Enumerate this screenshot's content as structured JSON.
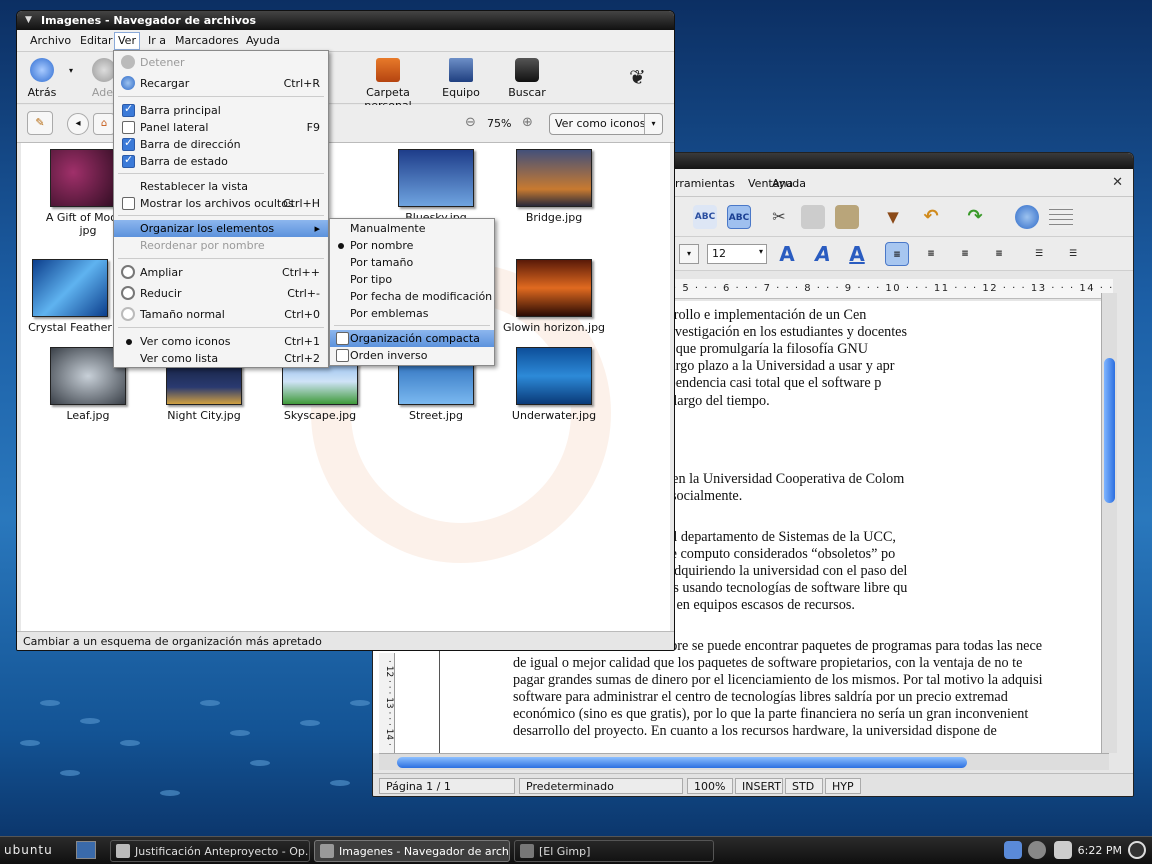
{
  "writer": {
    "menu": [
      "rramientas",
      "Ventana",
      "Ayuda"
    ],
    "fontsize": "12",
    "ruler": "· 5 · · · 6 · · · 7 · · · 8 · · · 9 · · · 10 · · · 11 · · · 12 · · · 13 · · · 14 · · · 15 ·",
    "vruler": "· 12 · · · 13 · · · 14 ·",
    "paragraphs": [
      "ventajas que tendría el desarrollo e implementación de un Cen",
      "UCC es que fomentaría la investigación en los estudiantes y docentes",
      "entas no privativas, a su vez que promulgaría la filosofía GNU",
      "o cual podría influenciar a largo plazo a la Universidad a usar y apr",
      "re libre rompiendo así la dependencia casi total que el software p",
      "e usuarios informáticos a lo largo del tiempo.",
      "centro de tecnologías libres en la Universidad Cooperativa de Colom",
      "ctible técnica, económica y socialmente.",
      "or medio de una entrevista al departamento de Sistemas de la UCC,",
      "rsidad dispone de equipos de computo considerados “obsoletos” po",
      "ologías de software que va adquiriendo la universidad con el paso del",
      "pos pueden ser aprovechados usando tecnologías de software libre qu",
      "para funcionar óptimamente en equipos escasos de recursos.",
      "En el mundo del software libre se puede encontrar paquetes de programas para todas las nece",
      "de igual o mejor calidad que los paquetes de software propietarios, con la ventaja de no te",
      "pagar grandes sumas de dinero por el licenciamiento de los mismos. Por tal motivo la adquisi",
      "software para administrar el centro de tecnologías libres saldría por un precio extremad",
      "económico (sino es que gratis), por lo que la parte financiera no sería un gran inconvenient",
      "desarrollo del proyecto. En cuanto a los recursos hardware, la universidad dispone de"
    ],
    "status": {
      "page": "Página  1 / 1",
      "style": "Predeterminado",
      "zoom": "100%",
      "insert": "INSERT",
      "std": "STD",
      "hyp": "HYP"
    }
  },
  "nautilus": {
    "title": "Imagenes - Navegador de archivos",
    "menu": [
      "Archivo",
      "Editar",
      "Ver",
      "Ir a",
      "Marcadores",
      "Ayuda"
    ],
    "toolbar": {
      "back": "Atrás",
      "forward": "Adel",
      "home": "Carpeta personal",
      "computer": "Equipo",
      "search": "Buscar"
    },
    "zoom": "75%",
    "view_mode": "Ver como iconos",
    "files": [
      {
        "name": "A Gift of Moonlight.jpg",
        "line1": "A Gift of Moonli",
        "line2": "jpg",
        "color": "#3a1030"
      },
      {
        "name": "Bluesky.jpg",
        "line1": "Bluesky.jpg",
        "line2": "",
        "color": "#3b6fbf"
      },
      {
        "name": "Bridge.jpg",
        "line1": "Bridge.jpg",
        "line2": "",
        "color": "#2c3650"
      },
      {
        "name": "Crystal Feather.jpg",
        "line1": "Crystal Feather",
        "line2": "",
        "color": "#1f6fb0"
      },
      {
        "name": "Glowin horizon.jpg",
        "line1": "Glowin horizon.jpg",
        "line2": "",
        "color": "#a8461c"
      },
      {
        "name": "Leaf.jpg",
        "line1": "Leaf.jpg",
        "line2": "",
        "color": "#5d6670"
      },
      {
        "name": "Night City.jpg",
        "line1": "Night City.jpg",
        "line2": "",
        "color": "#1a2540"
      },
      {
        "name": "Skyscape.jpg",
        "line1": "Skyscape.jpg",
        "line2": "",
        "color": "#3f9a3a"
      },
      {
        "name": "Street.jpg",
        "line1": "Street.jpg",
        "line2": "",
        "color": "#2876c0"
      },
      {
        "name": "Underwater.jpg",
        "line1": "Underwater.jpg",
        "line2": "",
        "color": "#1157a8"
      }
    ],
    "status": "Cambiar a un esquema de organización más apretado"
  },
  "ver_menu": {
    "detener": "Detener",
    "recargar": "Recargar",
    "recargar_acc": "Ctrl+R",
    "barra_principal": "Barra principal",
    "panel_lateral": "Panel lateral",
    "panel_lateral_acc": "F9",
    "barra_direccion": "Barra de dirección",
    "barra_estado": "Barra de estado",
    "restablecer": "Restablecer la vista",
    "ocultos": "Mostrar los archivos ocultos",
    "ocultos_acc": "Ctrl+H",
    "organizar": "Organizar los elementos",
    "reordenar": "Reordenar por nombre",
    "ampliar": "Ampliar",
    "ampliar_acc": "Ctrl++",
    "reducir": "Reducir",
    "reducir_acc": "Ctrl+-",
    "normal": "Tamaño normal",
    "normal_acc": "Ctrl+0",
    "iconos": "Ver como iconos",
    "iconos_acc": "Ctrl+1",
    "lista": "Ver como lista",
    "lista_acc": "Ctrl+2"
  },
  "sub_menu": {
    "manual": "Manualmente",
    "nombre": "Por nombre",
    "tamano": "Por tamaño",
    "tipo": "Por tipo",
    "fecha": "Por fecha de modificación",
    "emblemas": "Por emblemas",
    "compacta": "Organización compacta",
    "inverso": "Orden inverso"
  },
  "taskbar": {
    "logo": "ubuntu",
    "tasks": [
      "Justificación Anteproyecto - Op...",
      "Imagenes - Navegador de archivos",
      "[El Gimp]"
    ],
    "clock": "6:22 PM"
  }
}
